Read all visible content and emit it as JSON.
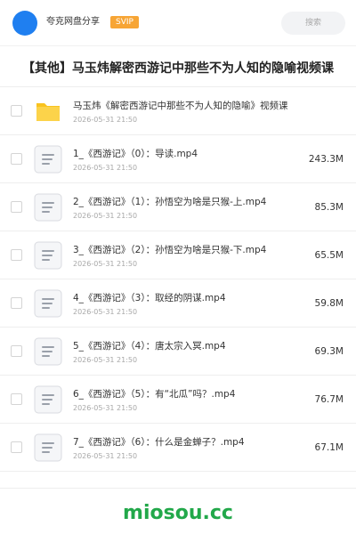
{
  "header": {
    "app_name": "夸克网盘分享",
    "vip_label": "SVIP",
    "search_placeholder": "搜索"
  },
  "folder_title": "【其他】马玉炜解密西游记中那些不为人知的隐喻视频课",
  "files": [
    {
      "name": "马玉炜《解密西游记中那些不为人知的隐喻》视频课",
      "date": "2026-05-31 21:50",
      "size": "",
      "type": "folder"
    },
    {
      "name": "1_《西游记》（0）：导读.mp4",
      "date": "2026-05-31 21:50",
      "size": "243.3M",
      "type": "file"
    },
    {
      "name": "2_《西游记》（1）：孙悟空为啥是只猴-上.mp4",
      "date": "2026-05-31 21:50",
      "size": "85.3M",
      "type": "file"
    },
    {
      "name": "3_《西游记》（2）：孙悟空为啥是只猴-下.mp4",
      "date": "2026-05-31 21:50",
      "size": "65.5M",
      "type": "file"
    },
    {
      "name": "4_《西游记》（3）：取经的阴谋.mp4",
      "date": "2026-05-31 21:50",
      "size": "59.8M",
      "type": "file"
    },
    {
      "name": "5_《西游记》（4）：唐太宗入冥.mp4",
      "date": "2026-05-31 21:50",
      "size": "69.3M",
      "type": "file"
    },
    {
      "name": "6_《西游记》（5）：有“北瓜”吗？.mp4",
      "date": "2026-05-31 21:50",
      "size": "76.7M",
      "type": "file"
    },
    {
      "name": "7_《西游记》（6）：什么是金蝉子？.mp4",
      "date": "2026-05-31 21:50",
      "size": "67.1M",
      "type": "file"
    }
  ],
  "watermark": "miosou.cc",
  "colors": {
    "avatar": "#1f7ff0",
    "vip_badge": "#f7a535",
    "folder": "#f9c31f",
    "watermark": "#22a84a"
  }
}
